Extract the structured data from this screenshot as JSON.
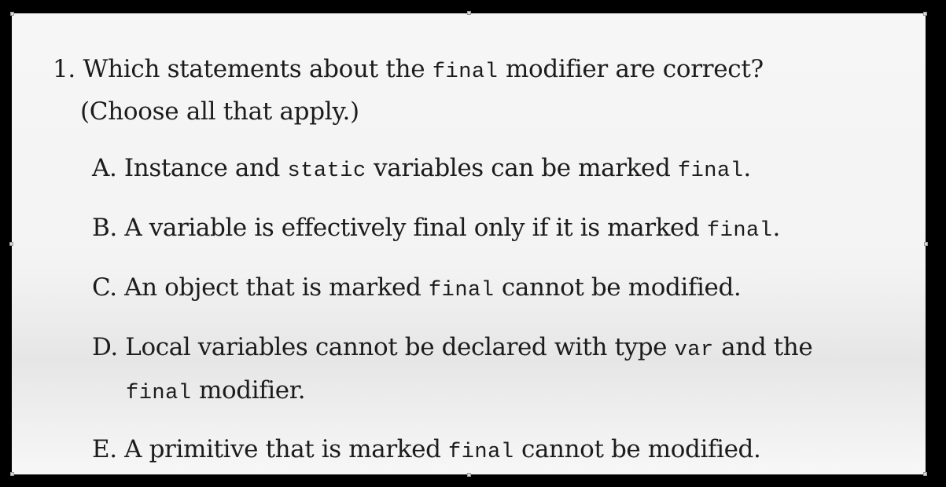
{
  "question": {
    "number": "1.",
    "text_before": "Which statements about the",
    "code_word": "final",
    "text_after": "modifier are correct?",
    "instruction": "(Choose all that apply.)"
  },
  "options": [
    {
      "letter": "A.",
      "t1": "Instance and",
      "c1": "static",
      "t2": "variables can be marked",
      "c2": "final",
      "t3": "."
    },
    {
      "letter": "B.",
      "t1": "A variable is effectively final only if it is marked",
      "c1": "final",
      "t2": "."
    },
    {
      "letter": "C.",
      "t1": "An object that is marked",
      "c1": "final",
      "t2": "cannot be modified."
    },
    {
      "letter": "D.",
      "t1": "Local variables cannot be declared with type",
      "c1": "var",
      "t2": "and the",
      "line2_code": "final",
      "line2_text": "modifier."
    },
    {
      "letter": "E.",
      "t1": "A primitive that is marked",
      "c1": "final",
      "t2": "cannot be modified."
    }
  ]
}
